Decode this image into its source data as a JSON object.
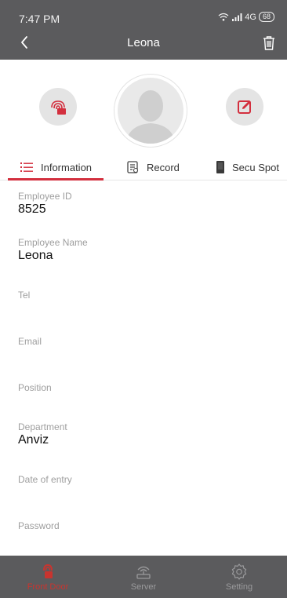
{
  "status_bar": {
    "time": "7:47 PM",
    "network": "4G",
    "battery": "68"
  },
  "header": {
    "title": "Leona"
  },
  "tabs": [
    {
      "label": "Information",
      "active": true
    },
    {
      "label": "Record",
      "active": false
    },
    {
      "label": "Secu Spot",
      "active": false
    }
  ],
  "fields": [
    {
      "label": "Employee ID",
      "value": "8525"
    },
    {
      "label": "Employee Name",
      "value": "Leona"
    },
    {
      "label": "Tel",
      "value": ""
    },
    {
      "label": "Email",
      "value": ""
    },
    {
      "label": "Position",
      "value": ""
    },
    {
      "label": "Department",
      "value": "Anviz"
    },
    {
      "label": "Date of entry",
      "value": ""
    },
    {
      "label": "Password",
      "value": ""
    }
  ],
  "bottom_nav": [
    {
      "label": "Front Door",
      "icon": "door-lock-icon",
      "active": true
    },
    {
      "label": "Server",
      "icon": "router-icon",
      "active": false
    },
    {
      "label": "Setting",
      "icon": "gear-icon",
      "active": false
    }
  ],
  "colors": {
    "accent": "#d32f3e",
    "bar": "#5b5b5d"
  }
}
